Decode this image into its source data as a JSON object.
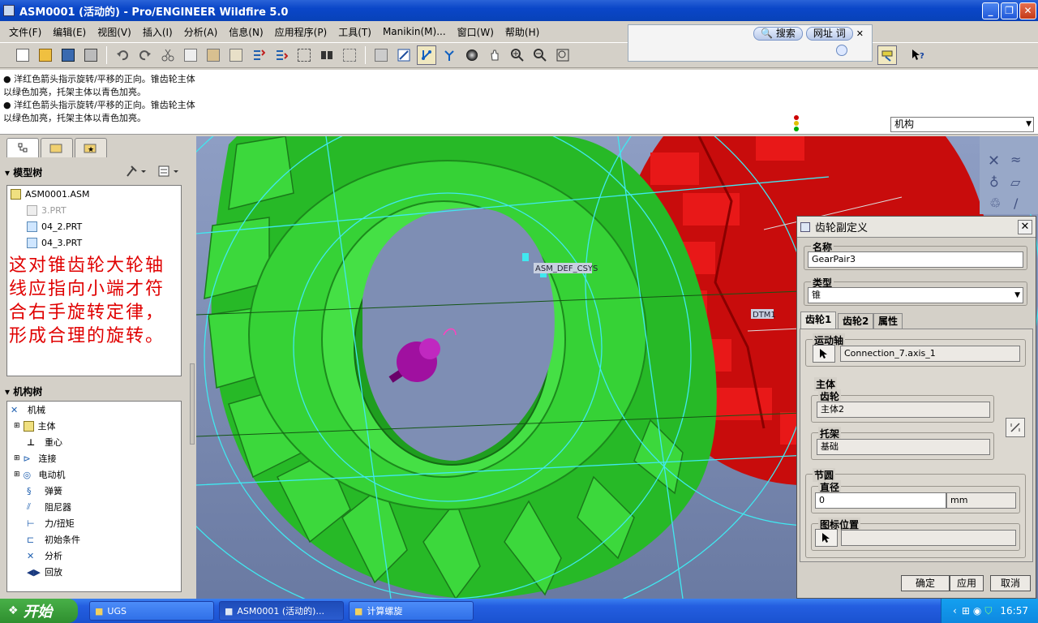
{
  "window": {
    "title": "ASM0001 (活动的) - Pro/ENGINEER Wildfire 5.0",
    "controls": [
      "_",
      "❐",
      "✕"
    ]
  },
  "menu": [
    "文件(F)",
    "编辑(E)",
    "视图(V)",
    "插入(I)",
    "分析(A)",
    "信息(N)",
    "应用程序(P)",
    "工具(T)",
    "Manikin(M)...",
    "窗口(W)",
    "帮助(H)"
  ],
  "search_popup": {
    "search_label": "搜索",
    "url_label": "网址",
    "word_label": "词",
    "close": "✕"
  },
  "messages": [
    "● 洋红色箭头指示旋转/平移的正向。锥齿轮主体",
    "以绿色加亮，托架主体以青色加亮。",
    "● 洋红色箭头指示旋转/平移的正向。锥齿轮主体",
    "以绿色加亮，托架主体以青色加亮。"
  ],
  "filter": {
    "value": "机构"
  },
  "model_tree": {
    "title": "模型树",
    "items": [
      {
        "label": "ASM0001.ASM",
        "grey": false
      },
      {
        "label": "3.PRT",
        "grey": true
      },
      {
        "label": "04_2.PRT",
        "grey": false
      },
      {
        "label": "04_3.PRT",
        "grey": false
      }
    ]
  },
  "annotation": "这对锥齿轮大轮轴线应指向小端才符合右手旋转定律，形成合理的旋转。",
  "mech_tree": {
    "title": "机构树",
    "root": "机械",
    "items": [
      "主体",
      "重心",
      "连接",
      "电动机",
      "弹簧",
      "阻尼器",
      "力/扭矩",
      "初始条件",
      "分析",
      "回放"
    ]
  },
  "viewport": {
    "labels": [
      "ASM_DEF_CSYS",
      "DTM1"
    ]
  },
  "dialog": {
    "title": "齿轮副定义",
    "name_label": "名称",
    "name_value": "GearPair3",
    "type_label": "类型",
    "type_value": "锥",
    "tabs": [
      "齿轮1",
      "齿轮2",
      "属性"
    ],
    "motion_axis_label": "运动轴",
    "motion_axis_value": "Connection_7.axis_1",
    "body_label": "主体",
    "gear_label": "齿轮",
    "gear_value": "主体2",
    "carrier_label": "托架",
    "carrier_value": "基础",
    "pitch_label": "节圆",
    "diameter_label": "直径",
    "diameter_value": "0",
    "unit": "mm",
    "icon_pos_label": "图标位置",
    "icon_pos_value": "",
    "ok": "确定",
    "apply": "应用",
    "cancel": "取消"
  },
  "taskbar": {
    "start": "开始",
    "tasks": [
      "UGS",
      "ASM0001 (活动的)...",
      "计算螺旋"
    ],
    "clock": "16:57"
  },
  "colors": {
    "gear_green": "#2fbf2f",
    "gear_red": "#d81010",
    "wire_cyan": "#40e8f0",
    "annotation_red": "#e00000"
  }
}
